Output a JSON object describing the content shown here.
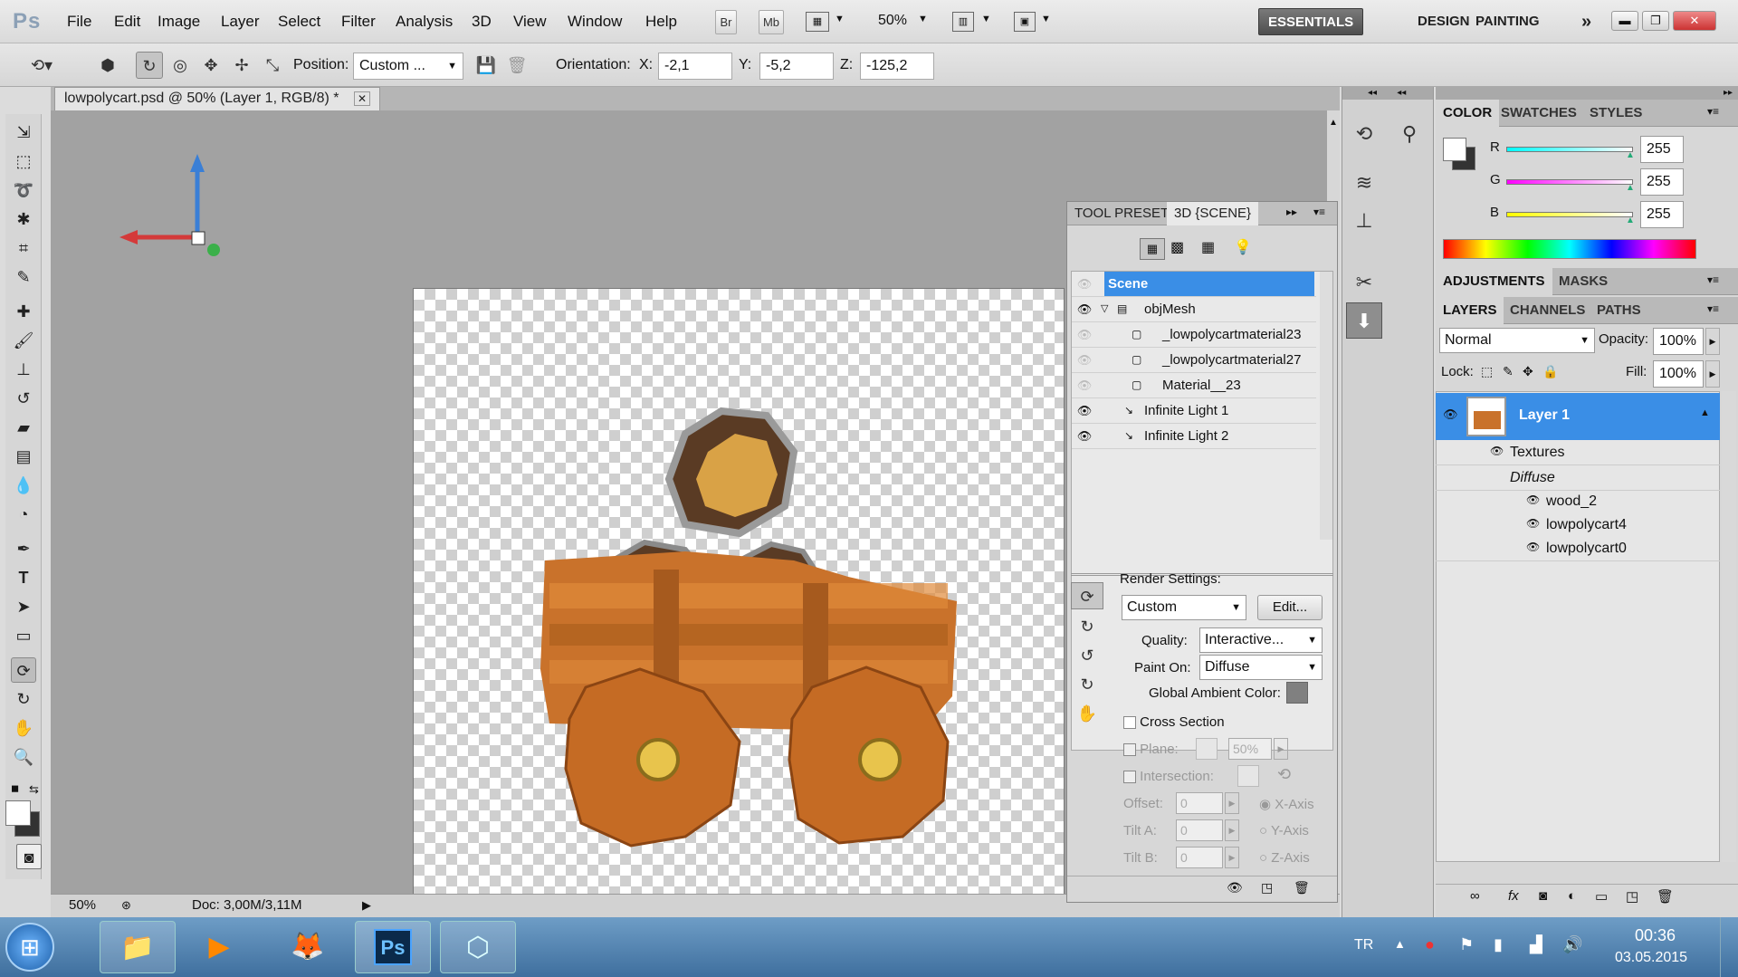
{
  "app": {
    "logo": "Ps"
  },
  "menu": [
    "File",
    "Edit",
    "Image",
    "Layer",
    "Select",
    "Filter",
    "Analysis",
    "3D",
    "View",
    "Window",
    "Help"
  ],
  "menubar_buttons": {
    "br": "Br",
    "mb": "Mb",
    "zoom": "50%"
  },
  "workspaces": {
    "essentials": "ESSENTIALS",
    "design": "DESIGN",
    "painting": "PAINTING",
    "more": "»"
  },
  "options": {
    "position_label": "Position:",
    "position_value": "Custom ...",
    "orientation_label": "Orientation:",
    "x_label": "X:",
    "x_value": "-2,1",
    "y_label": "Y:",
    "y_value": "-5,2",
    "z_label": "Z:",
    "z_value": "-125,2"
  },
  "document": {
    "tab_title": "lowpolycart.psd @ 50% (Layer 1, RGB/8) *",
    "zoom": "50%",
    "doc_info": "Doc: 3,00M/3,11M"
  },
  "scene_panel": {
    "tabs": [
      "TOOL PRESET",
      "3D {SCENE}"
    ],
    "rows": [
      {
        "label": "Scene"
      },
      {
        "label": "objMesh"
      },
      {
        "label": "_lowpolycartmaterial23"
      },
      {
        "label": "_lowpolycartmaterial27"
      },
      {
        "label": "Material__23"
      },
      {
        "label": "Infinite Light 1"
      },
      {
        "label": "Infinite Light 2"
      }
    ],
    "render_settings_label": "Render Settings:",
    "render_preset": "Custom",
    "edit_button": "Edit...",
    "quality_label": "Quality:",
    "quality_value": "Interactive...",
    "paint_on_label": "Paint On:",
    "paint_on_value": "Diffuse",
    "ambient_label": "Global Ambient Color:",
    "cross_section_label": "Cross Section",
    "plane_label": "Plane:",
    "plane_value": "50%",
    "intersection_label": "Intersection:",
    "offset_label": "Offset:",
    "offset_value": "0",
    "tilt_a_label": "Tilt A:",
    "tilt_a_value": "0",
    "tilt_b_label": "Tilt B:",
    "tilt_b_value": "0",
    "x_axis": "X-Axis",
    "y_axis": "Y-Axis",
    "z_axis": "Z-Axis"
  },
  "color_panel": {
    "tabs": [
      "COLOR",
      "SWATCHES",
      "STYLES"
    ],
    "r_label": "R",
    "r_value": "255",
    "g_label": "G",
    "g_value": "255",
    "b_label": "B",
    "b_value": "255"
  },
  "adjust_panel": {
    "tabs": [
      "ADJUSTMENTS",
      "MASKS"
    ]
  },
  "layers_panel": {
    "tabs": [
      "LAYERS",
      "CHANNELS",
      "PATHS"
    ],
    "blend_mode": "Normal",
    "opacity_label": "Opacity:",
    "opacity_value": "100%",
    "lock_label": "Lock:",
    "fill_label": "Fill:",
    "fill_value": "100%",
    "layer_name": "Layer 1",
    "textures_label": "Textures",
    "diffuse_label": "Diffuse",
    "textures": [
      "wood_2",
      "lowpolycart4",
      "lowpolycart0"
    ]
  },
  "taskbar": {
    "lang": "TR",
    "time": "00:36",
    "date": "03.05.2015",
    "ps_label": "Ps"
  },
  "colors": {
    "accent": "#3a8ee6",
    "taskbar": "#4b7fb0",
    "canvas_bg": "#a2a2a2"
  }
}
